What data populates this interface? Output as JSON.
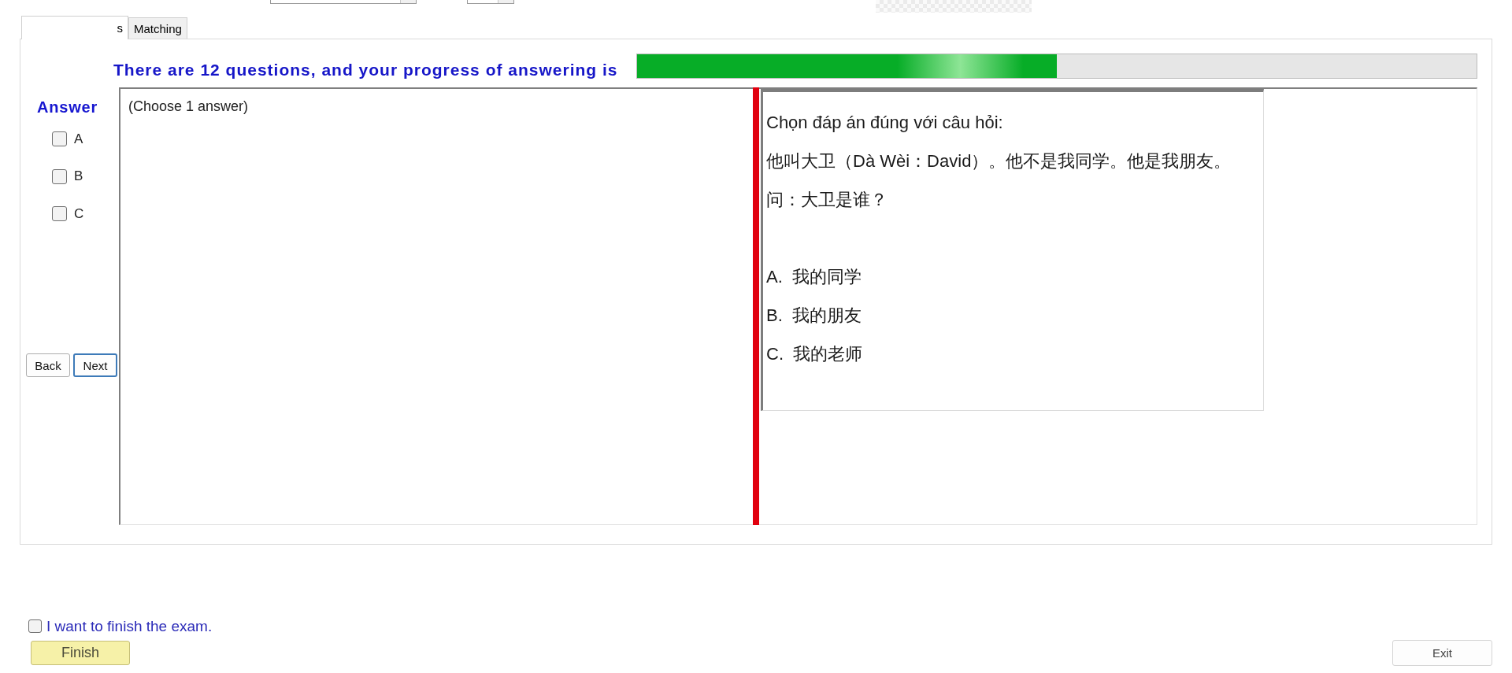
{
  "top_bar": {
    "controls": [
      {
        "kind": "dropdown"
      },
      {
        "kind": "dropdown"
      },
      {
        "kind": "image"
      }
    ]
  },
  "tabs": [
    {
      "label": "s",
      "selected": true
    },
    {
      "label": "Matching",
      "selected": false
    }
  ],
  "progress": {
    "text": "There are 12 questions, and your progress of answering is",
    "level": 0.5
  },
  "answer": {
    "title": "Answer",
    "options": [
      {
        "label": "A",
        "checked": false
      },
      {
        "label": "B",
        "checked": false
      },
      {
        "label": "C",
        "checked": false
      }
    ],
    "buttons": [
      {
        "label": "Back",
        "focused": false
      },
      {
        "label": "Next",
        "focused": true
      }
    ],
    "note": "(Choose 1 answer)"
  },
  "question": {
    "lines": [
      "Chọn đáp án đúng với câu hỏi:",
      "他叫大卫（Dà Wèi：David）。他不是我同学。他是我朋友。",
      "问：大卫是谁？"
    ],
    "choices": [
      "A.  我的同学",
      "B.  我的朋友",
      "C.  我的老师"
    ]
  },
  "finish": {
    "label": "I want to finish the exam.",
    "checked": false,
    "button": "Finish"
  },
  "exit_button": "Exit"
}
